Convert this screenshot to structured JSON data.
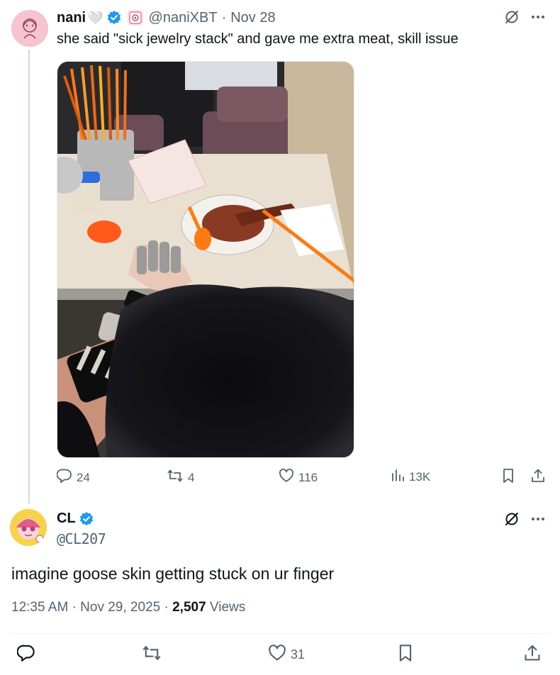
{
  "tweet": {
    "name": "nani",
    "name_suffix": "🤍",
    "handle": "@naniXBT",
    "separator": "·",
    "date": "Nov 28",
    "text": "she said \"sick jewelry stack\" and gave me extra meat, skill issue",
    "stats": {
      "replies": "24",
      "reposts": "4",
      "likes": "116",
      "views": "13K"
    }
  },
  "reply": {
    "name": "CL",
    "handle": "@CL207",
    "text": "imagine goose skin getting stuck on ur finger",
    "time": "12:35 AM",
    "date": "Nov 29, 2025",
    "views_count": "2,507",
    "views_label": "Views",
    "likes": "31"
  },
  "colors": {
    "verified": "#1d9bf0",
    "text_primary": "#0f1419",
    "text_secondary": "#536471",
    "thread_line": "#cfd9de"
  },
  "icons": [
    "grok-icon",
    "more-icon",
    "reply-icon",
    "repost-icon",
    "like-icon",
    "views-icon",
    "bookmark-icon",
    "share-icon",
    "verified-icon"
  ]
}
